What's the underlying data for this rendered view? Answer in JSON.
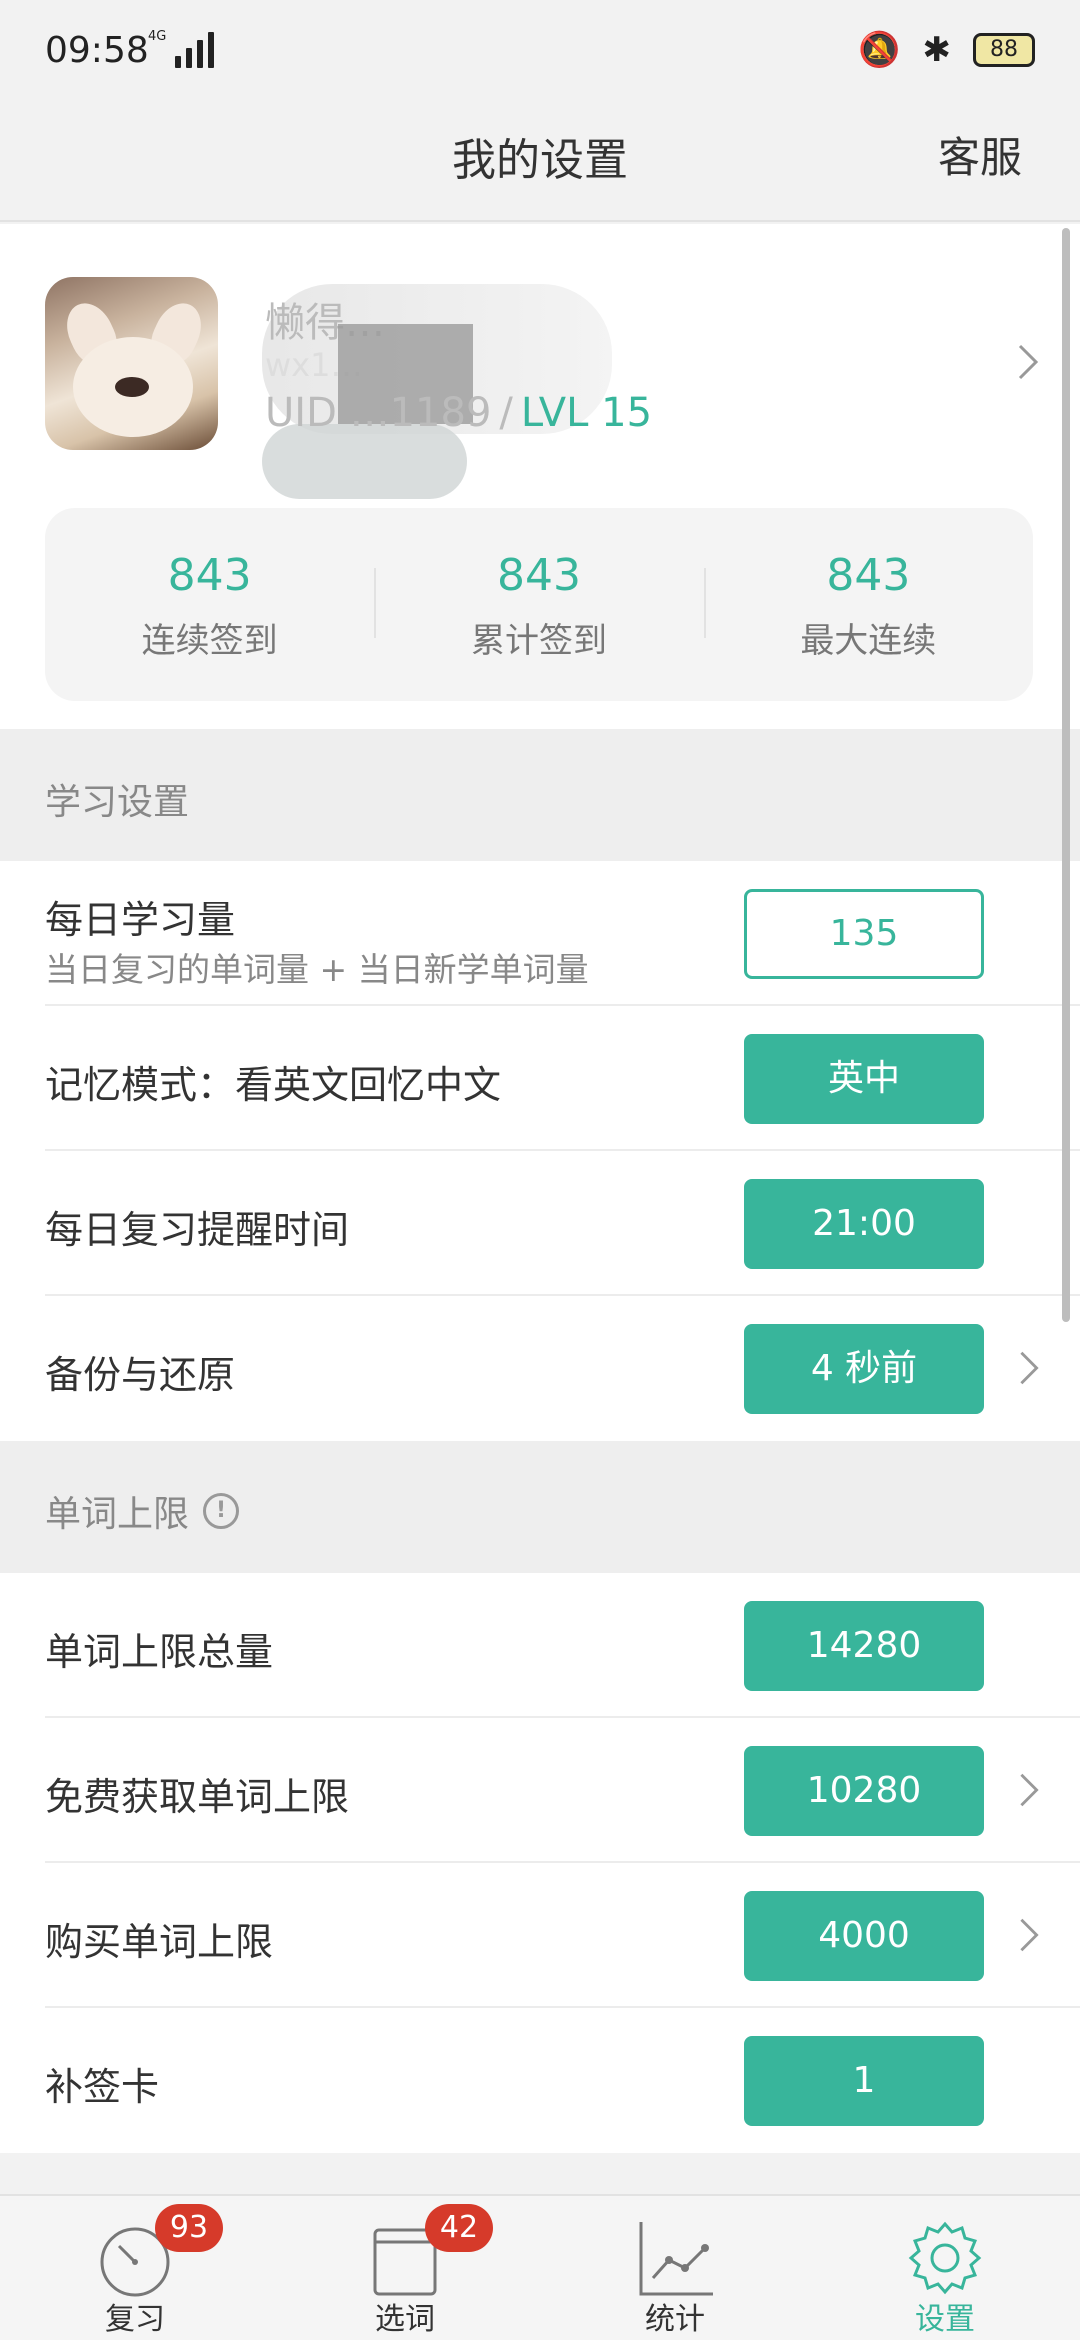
{
  "status_bar": {
    "time": "09:58",
    "network": "4G",
    "battery": "88"
  },
  "header": {
    "title": "我的设置",
    "service_link": "客服"
  },
  "profile": {
    "nickname": "懒得…",
    "wx_id": "wx1…",
    "uid": "UID …1189",
    "separator": "/",
    "level": "LVL 15",
    "stats": [
      {
        "value": "843",
        "label": "连续签到"
      },
      {
        "value": "843",
        "label": "累计签到"
      },
      {
        "value": "843",
        "label": "最大连续"
      }
    ]
  },
  "study_section": {
    "title": "学习设置",
    "daily_amount": {
      "label": "每日学习量",
      "sub": "当日复习的单词量 + 当日新学单词量",
      "value": "135"
    },
    "memory_mode": {
      "label": "记忆模式：看英文回忆中文",
      "value": "英中"
    },
    "reminder_time": {
      "label": "每日复习提醒时间",
      "value": "21:00"
    },
    "backup": {
      "label": "备份与还原",
      "value": "4 秒前"
    }
  },
  "limit_section": {
    "title": "单词上限",
    "total": {
      "label": "单词上限总量",
      "value": "14280"
    },
    "free": {
      "label": "免费获取单词上限",
      "value": "10280"
    },
    "purchase": {
      "label": "购买单词上限",
      "value": "4000"
    },
    "makeup_card": {
      "label": "补签卡",
      "value": "1"
    }
  },
  "bottom_nav": {
    "items": [
      {
        "label": "复习",
        "badge": "93"
      },
      {
        "label": "选词",
        "badge": "42"
      },
      {
        "label": "统计"
      },
      {
        "label": "设置"
      }
    ]
  },
  "colors": {
    "accent": "#38b59b",
    "badge": "#d63a2a"
  }
}
